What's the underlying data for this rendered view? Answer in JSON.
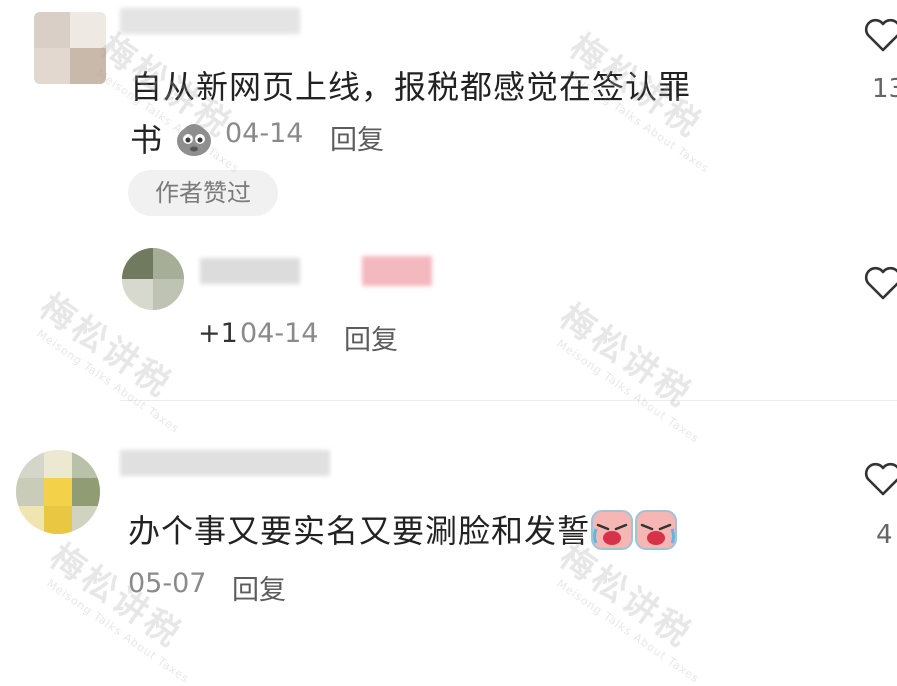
{
  "comments": [
    {
      "text_line1": "自从新网页上线，报税都感觉在签认罪",
      "text_line2": "书",
      "emoji": "ghost-emoji",
      "date": "04-14",
      "reply_label": "回复",
      "author_liked_label": "作者赞过",
      "like_count": "13"
    },
    {
      "prefix": "+1",
      "date": "04-14",
      "reply_label": "回复"
    },
    {
      "text": "办个事又要实名又要涮脸和发誓",
      "emojis": [
        "crying-emoji",
        "crying-emoji"
      ],
      "date": "05-07",
      "reply_label": "回复",
      "like_count": "4"
    }
  ],
  "watermark": {
    "text": "梅松讲税",
    "subtext": "Meisong Talks About Taxes"
  },
  "colors": {
    "text": "#222222",
    "meta": "#8a8a8a",
    "tag_bg": "#f1f1f1",
    "like_outline": "#333333"
  }
}
